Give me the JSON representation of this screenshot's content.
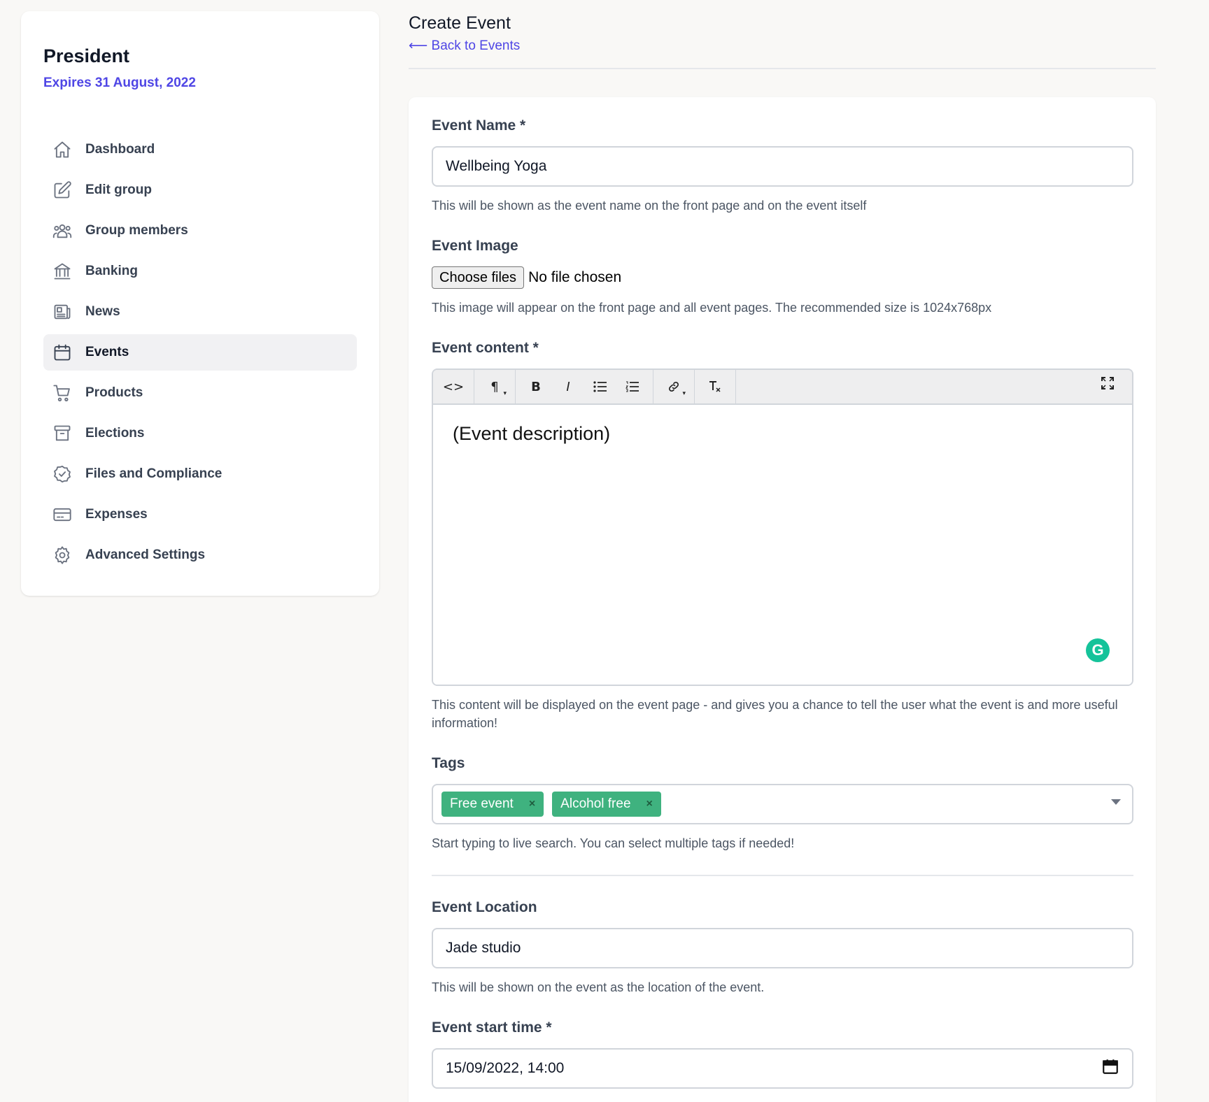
{
  "sidebar": {
    "role": "President",
    "expires": "Expires 31 August, 2022",
    "items": [
      {
        "label": "Dashboard",
        "icon": "home-icon"
      },
      {
        "label": "Edit group",
        "icon": "edit-icon"
      },
      {
        "label": "Group members",
        "icon": "users-icon"
      },
      {
        "label": "Banking",
        "icon": "bank-icon"
      },
      {
        "label": "News",
        "icon": "newspaper-icon"
      },
      {
        "label": "Events",
        "icon": "calendar-icon",
        "active": true
      },
      {
        "label": "Products",
        "icon": "cart-icon"
      },
      {
        "label": "Elections",
        "icon": "archive-icon"
      },
      {
        "label": "Files and Compliance",
        "icon": "badge-check-icon"
      },
      {
        "label": "Expenses",
        "icon": "credit-card-icon"
      },
      {
        "label": "Advanced Settings",
        "icon": "gear-icon"
      }
    ]
  },
  "header": {
    "title": "Create Event",
    "back_link": "⟵ Back to Events"
  },
  "form": {
    "name": {
      "label": "Event Name *",
      "value": "Wellbeing Yoga",
      "help": "This will be shown as the event name on the front page and on the event itself"
    },
    "image": {
      "label": "Event Image",
      "button": "Choose files",
      "status": "No file chosen",
      "help": "This image will appear on the front page and all event pages. The recommended size is 1024x768px"
    },
    "content": {
      "label": "Event content *",
      "value": "(Event description)",
      "help": "This content will be displayed on the event page - and gives you a chance to tell the user what the event is and more useful information!",
      "toolbar": {
        "code": "<>",
        "paragraph": "¶",
        "bold": "B",
        "italic": "I",
        "fullscreen": "⛶"
      }
    },
    "tags": {
      "label": "Tags",
      "selected": [
        "Free event",
        "Alcohol free"
      ],
      "remove_glyph": "×",
      "help": "Start typing to live search. You can select multiple tags if needed!"
    },
    "location": {
      "label": "Event Location",
      "value": "Jade studio",
      "help": "This will be shown on the event as the location of the event."
    },
    "start_time": {
      "label": "Event start time *",
      "value": "15/09/2022, 14:00"
    }
  },
  "colors": {
    "accent": "#4f46e5",
    "tag": "#3fb27f",
    "grammarly": "#15c39a"
  }
}
